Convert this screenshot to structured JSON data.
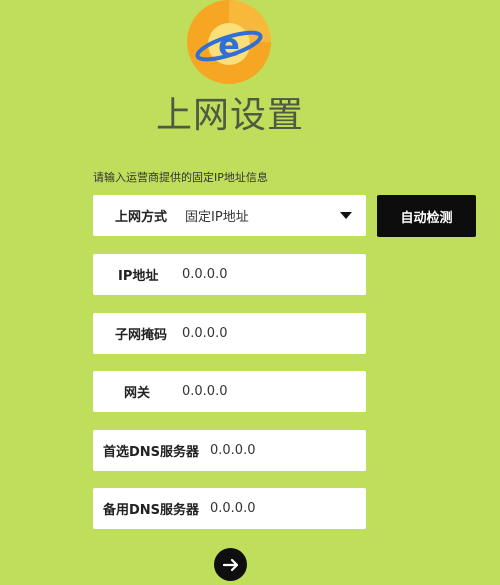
{
  "header": {
    "title": "上网设置",
    "logo_icon": "internet-explorer-style-globe-icon"
  },
  "subtitle": "请输入运营商提供的固定IP地址信息",
  "form": {
    "connection_type": {
      "label": "上网方式",
      "value": "固定IP地址"
    },
    "auto_detect_label": "自动检测",
    "ip_address": {
      "label": "IP地址",
      "value": "0.0.0.0"
    },
    "subnet_mask": {
      "label": "子网掩码",
      "value": "0.0.0.0"
    },
    "gateway": {
      "label": "网关",
      "value": "0.0.0.0"
    },
    "primary_dns": {
      "label": "首选DNS服务器",
      "value": "0.0.0.0"
    },
    "secondary_dns": {
      "label": "备用DNS服务器",
      "value": "0.0.0.0"
    }
  },
  "next_button_icon": "arrow-right-icon",
  "colors": {
    "background": "#bfdf5c",
    "title": "#4f5a40",
    "button": "#0d0d0d",
    "logo_orange": "#f5a623",
    "logo_blue": "#2f6fd6"
  }
}
